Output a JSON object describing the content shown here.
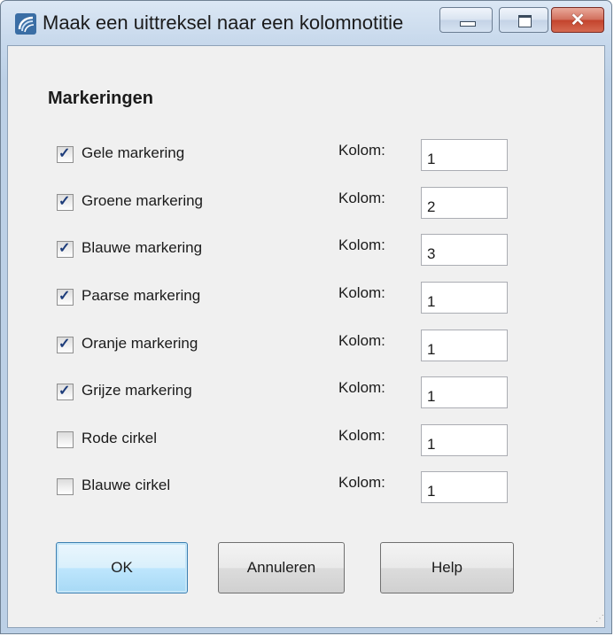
{
  "window": {
    "title": "Maak een uittreksel naar een kolomnotitie",
    "minimize_label": "minimize",
    "maximize_label": "maximize",
    "close_label": "✕"
  },
  "section": {
    "title": "Markeringen"
  },
  "rows": [
    {
      "label": "Gele markering",
      "checked": true,
      "kolom_label": "Kolom:",
      "value": "1"
    },
    {
      "label": "Groene markering",
      "checked": true,
      "kolom_label": "Kolom:",
      "value": "2"
    },
    {
      "label": "Blauwe markering",
      "checked": true,
      "kolom_label": "Kolom:",
      "value": "3"
    },
    {
      "label": "Paarse markering",
      "checked": true,
      "kolom_label": "Kolom:",
      "value": "1"
    },
    {
      "label": "Oranje markering",
      "checked": true,
      "kolom_label": "Kolom:",
      "value": "1"
    },
    {
      "label": "Grijze markering",
      "checked": true,
      "kolom_label": "Kolom:",
      "value": "1"
    },
    {
      "label": "Rode cirkel",
      "checked": false,
      "kolom_label": "Kolom:",
      "value": "1"
    },
    {
      "label": "Blauwe cirkel",
      "checked": false,
      "kolom_label": "Kolom:",
      "value": "1"
    }
  ],
  "buttons": {
    "ok": "OK",
    "cancel": "Annuleren",
    "help": "Help"
  },
  "icons": {
    "app": "app-swirl-icon",
    "check": "✓",
    "grip": "resize-grip-icon"
  },
  "colors": {
    "titlebar": "#c8d9ec",
    "close": "#c3432c",
    "ok_border": "#3c7fb1"
  }
}
